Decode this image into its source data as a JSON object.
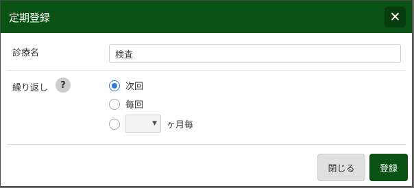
{
  "dialog": {
    "title": "定期登録",
    "close_glyph": "✕"
  },
  "form": {
    "treatment_label": "診療名",
    "treatment_value": "検査",
    "repeat_label": "繰り返し",
    "help_glyph": "?",
    "repeat_options": [
      {
        "label": "次回",
        "checked": true
      },
      {
        "label": "毎回",
        "checked": false
      },
      {
        "label": "ヶ月毎",
        "checked": false
      }
    ],
    "month_select_value": "",
    "select_caret": "▼"
  },
  "footer": {
    "close_label": "閉じる",
    "register_label": "登録"
  },
  "colors": {
    "header": "#0a5213",
    "primary_button": "#0a5213",
    "radio_checked": "#2f7bd6"
  }
}
